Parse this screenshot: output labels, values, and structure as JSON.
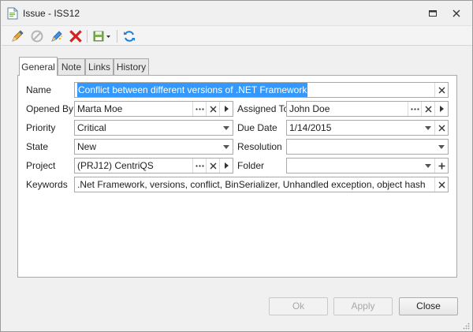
{
  "window": {
    "title": "Issue - ISS12"
  },
  "toolbar": {
    "items": [
      "edit-pencil-icon",
      "cancel-circle-icon",
      "edit-sparkle-icon",
      "delete-x-icon",
      "save-options-icon",
      "refresh-icon"
    ]
  },
  "tabs": [
    {
      "label": "General",
      "active": true
    },
    {
      "label": "Note",
      "active": false
    },
    {
      "label": "Links",
      "active": false
    },
    {
      "label": "History",
      "active": false
    }
  ],
  "form": {
    "name_label": "Name",
    "name_value": "Conflict between different versions of .NET Framework",
    "opened_by_label": "Opened By",
    "opened_by_value": "Marta Moe",
    "assigned_to_label": "Assigned To",
    "assigned_to_value": "John Doe",
    "priority_label": "Priority",
    "priority_value": "Critical",
    "due_date_label": "Due Date",
    "due_date_value": "1/14/2015",
    "state_label": "State",
    "state_value": "New",
    "resolution_label": "Resolution",
    "resolution_value": "",
    "project_label": "Project",
    "project_value": "(PRJ12) CentriQS",
    "folder_label": "Folder",
    "folder_value": "",
    "keywords_label": "Keywords",
    "keywords_value": ".Net Framework, versions, conflict, BinSerializer, Unhandled exception, object hash"
  },
  "buttons": {
    "ok": "Ok",
    "apply": "Apply",
    "close": "Close"
  },
  "colors": {
    "selection": "#3399ff",
    "delete_red": "#d42020",
    "refresh_blue": "#1e7fd8"
  }
}
